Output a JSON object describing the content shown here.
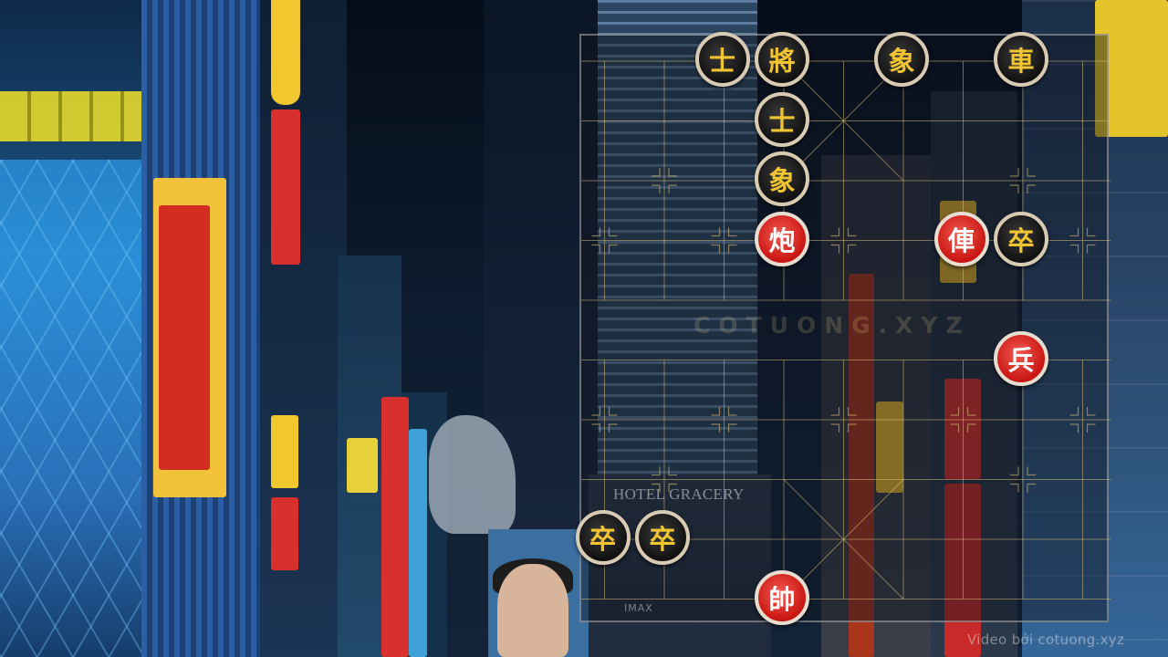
{
  "background": {
    "hotel_sign": "HOTEL GRACERY",
    "cinema_sign": "IMAX"
  },
  "board": {
    "watermark": "COTUONG.XYZ",
    "footer_watermark": "Video bởi cotuong.xyz",
    "line_color": "#e1c378",
    "columns": 9,
    "rows": 10
  },
  "pieces": [
    {
      "id": "black-advisor-1",
      "char": "士",
      "side": "black",
      "col": 3,
      "row": 0
    },
    {
      "id": "black-general",
      "char": "將",
      "side": "black",
      "col": 4,
      "row": 0
    },
    {
      "id": "black-elephant-1",
      "char": "象",
      "side": "black",
      "col": 6,
      "row": 0
    },
    {
      "id": "black-chariot",
      "char": "車",
      "side": "black",
      "col": 8,
      "row": 0
    },
    {
      "id": "black-advisor-2",
      "char": "士",
      "side": "black",
      "col": 4,
      "row": 1
    },
    {
      "id": "black-elephant-2",
      "char": "象",
      "side": "black",
      "col": 4,
      "row": 2
    },
    {
      "id": "red-cannon",
      "char": "炮",
      "side": "red",
      "col": 4,
      "row": 3
    },
    {
      "id": "red-chariot",
      "char": "俥",
      "side": "red",
      "col": 7,
      "row": 3
    },
    {
      "id": "black-soldier-1",
      "char": "卒",
      "side": "black",
      "col": 8,
      "row": 3
    },
    {
      "id": "red-soldier",
      "char": "兵",
      "side": "red",
      "col": 8,
      "row": 5
    },
    {
      "id": "black-soldier-2",
      "char": "卒",
      "side": "black",
      "col": 1,
      "row": 8
    },
    {
      "id": "black-soldier-3",
      "char": "卒",
      "side": "black",
      "col": 2,
      "row": 8
    },
    {
      "id": "red-general",
      "char": "帥",
      "side": "red",
      "col": 4,
      "row": 9
    }
  ],
  "colors": {
    "black_piece_text": "#f1c532",
    "red_piece_fill": "#c91512",
    "piece_rim": "#d9cbb3"
  }
}
